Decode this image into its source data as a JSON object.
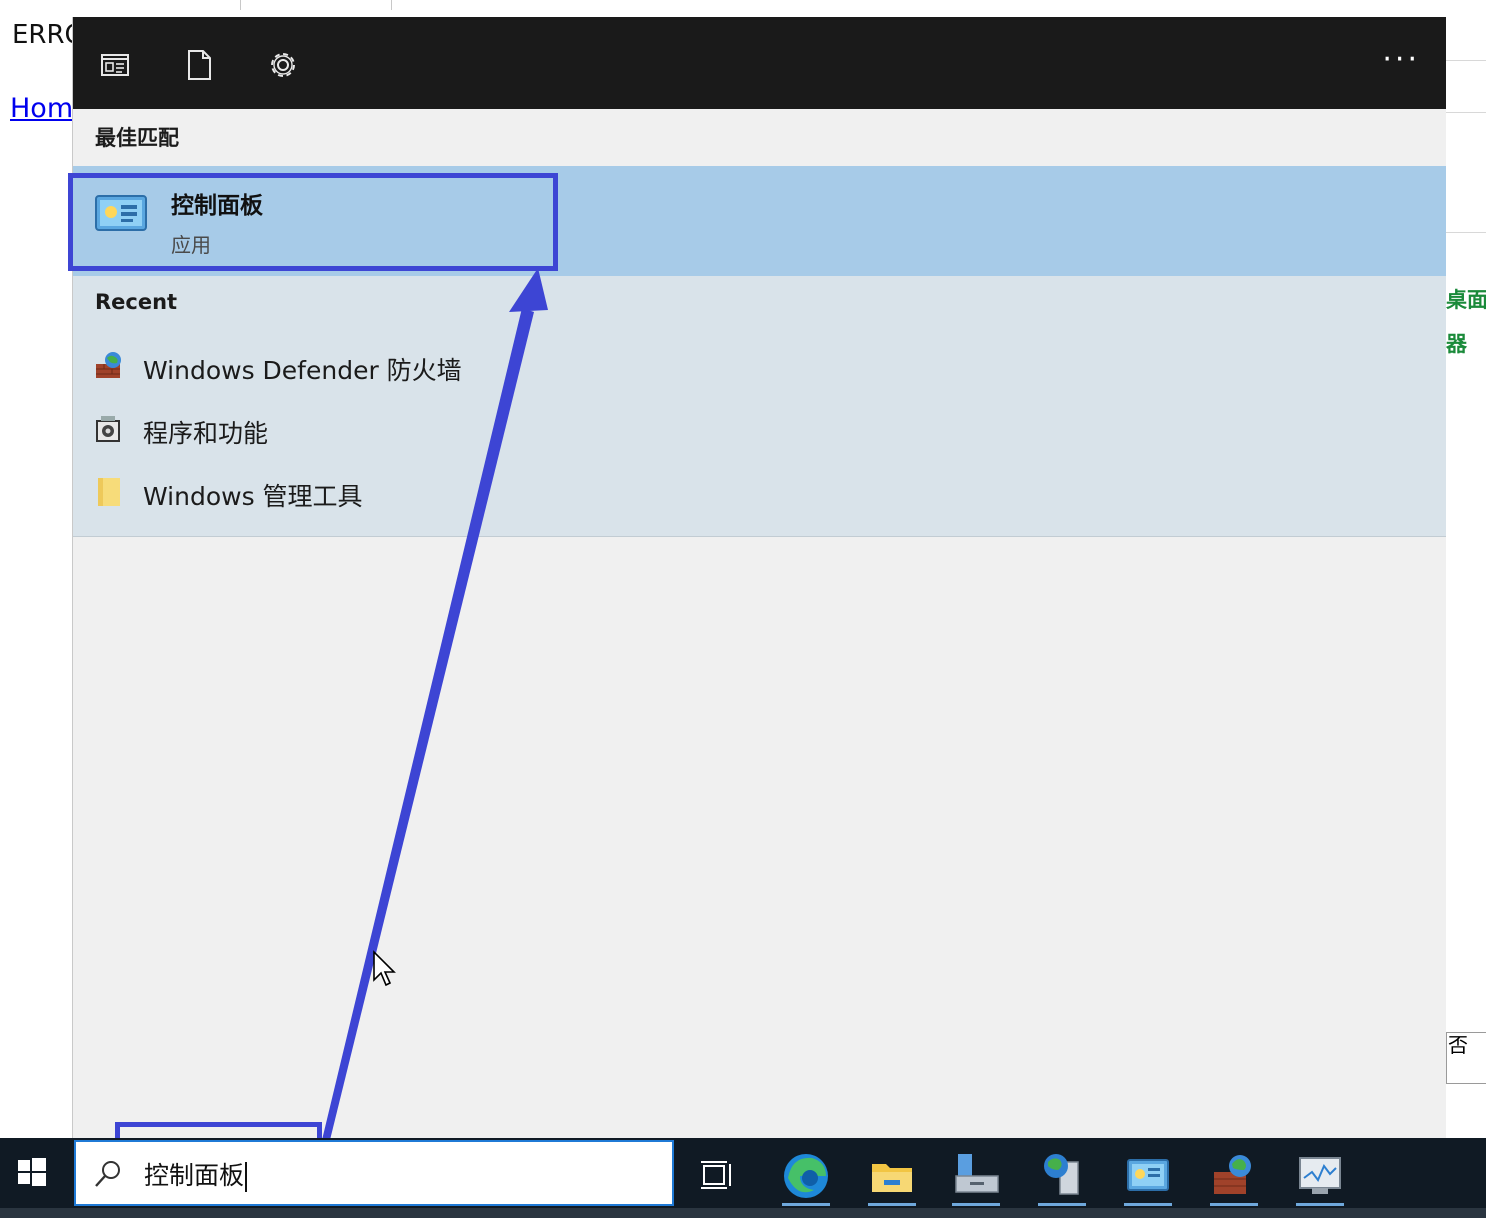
{
  "background": {
    "error_text": "ERRO",
    "home_link": "Hom",
    "right_labels": [
      "桌面",
      "器"
    ],
    "right_box_text": "否"
  },
  "panel": {
    "top_icons": [
      "document-view-icon",
      "document-icon",
      "gear-icon"
    ],
    "more_label": "···",
    "best_match_header": "最佳匹配",
    "best_match": {
      "title": "控制面板",
      "subtitle": "应用",
      "icon": "control-panel-icon"
    },
    "recent_header": "Recent",
    "recent_items": [
      {
        "label": "Windows Defender 防火墙",
        "icon": "firewall-icon"
      },
      {
        "label": "程序和功能",
        "icon": "programs-features-icon"
      },
      {
        "label": "Windows 管理工具",
        "icon": "folder-icon"
      }
    ]
  },
  "taskbar": {
    "search_value": "控制面板",
    "apps": [
      "task-view-icon",
      "edge-icon",
      "file-explorer-icon",
      "server-manager-icon",
      "network-server-icon",
      "control-panel-icon",
      "firewall-icon",
      "performance-monitor-icon"
    ]
  },
  "colors": {
    "panel_top": "#1a1a1a",
    "best_match_bg": "#a7cbe8",
    "recent_bg": "#d9e3ea",
    "panel_bg": "#f0f0f0",
    "highlight": "#3d45d4",
    "taskbar": "#101a24"
  }
}
